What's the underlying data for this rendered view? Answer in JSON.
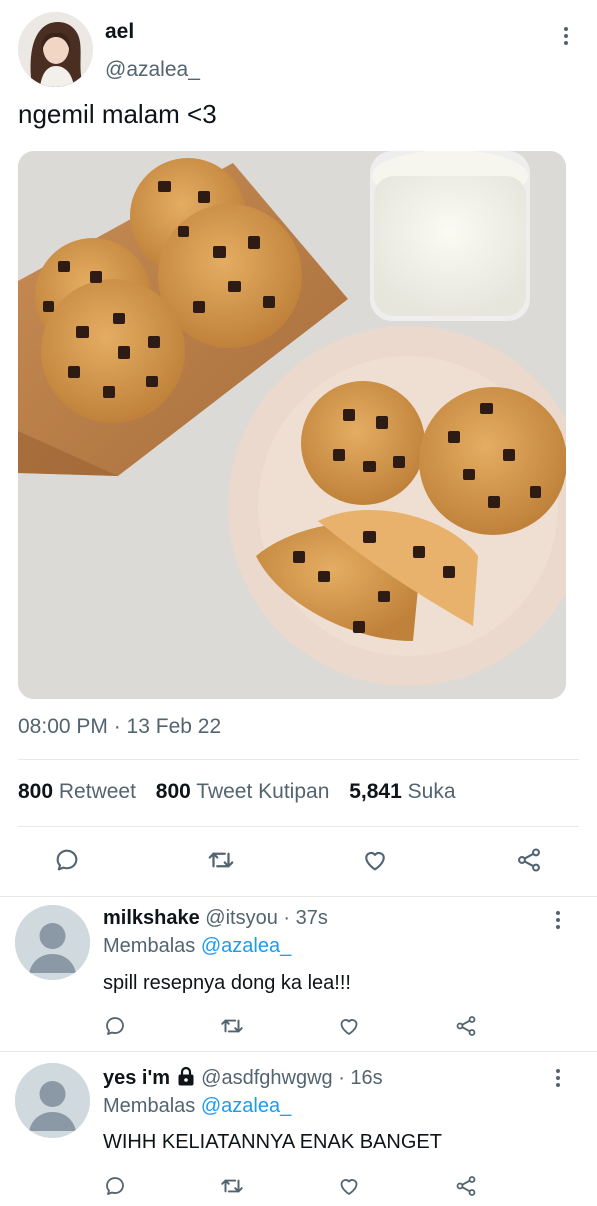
{
  "tweet": {
    "author_name": "ael",
    "author_handle": "@azalea_",
    "text": "ngemil malam <3",
    "timestamp": "08:00 PM · 13 Feb 22",
    "stats": {
      "retweets_count": "800",
      "retweets_label": "Retweet",
      "quotes_count": "800",
      "quotes_label": "Tweet Kutipan",
      "likes_count": "5,841",
      "likes_label": "Suka"
    }
  },
  "replies": [
    {
      "name": "milkshake",
      "handle": "@itsyou",
      "time": "· 37s",
      "replying_label": "Membalas",
      "replying_to": "@azalea_",
      "text": "spill resepnya dong ka lea!!!"
    },
    {
      "name": "yes i'm",
      "handle": "@asdfghwgwg",
      "time": "· 16s",
      "replying_label": "Membalas",
      "replying_to": "@azalea_",
      "text": "WIHH KELIATANNYA ENAK BANGET"
    }
  ],
  "colors": {
    "accent": "#1d9bf0",
    "muted": "#536471",
    "text": "#0f1419"
  },
  "icons": [
    "more-icon",
    "reply-icon",
    "retweet-icon",
    "like-icon",
    "share-icon",
    "lock-icon"
  ]
}
